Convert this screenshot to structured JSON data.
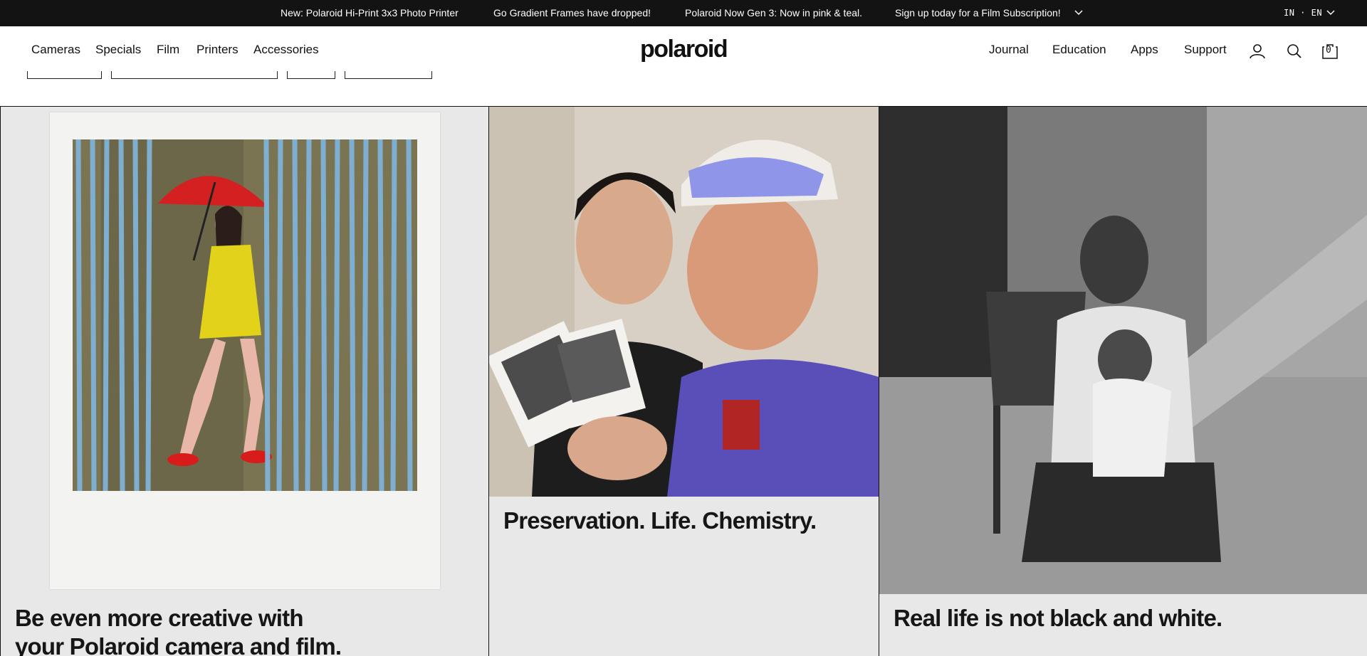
{
  "announcement": {
    "messages": [
      "New: Polaroid Hi-Print 3x3 Photo Printer",
      "Go Gradient Frames have dropped!",
      "Polaroid Now Gen 3: Now in pink & teal.",
      "Sign up today for a Film Subscription!"
    ],
    "locale": "IN · EN"
  },
  "nav": {
    "left": [
      "Cameras",
      "Specials",
      "Film",
      "Printers",
      "Accessories"
    ],
    "logo": "polaroid",
    "right": [
      "Journal",
      "Education",
      "Apps",
      "Support"
    ],
    "cart_count": "0"
  },
  "cards": [
    {
      "headline_line1": "Be even more creative with",
      "headline_line2": "your Polaroid camera and film."
    },
    {
      "headline": "Preservation. Life. Chemistry."
    },
    {
      "headline": "Real life is not black and white."
    }
  ],
  "colors": {
    "topbar": "#131313",
    "card_bg": "#e8e8e8",
    "text": "#111111"
  }
}
